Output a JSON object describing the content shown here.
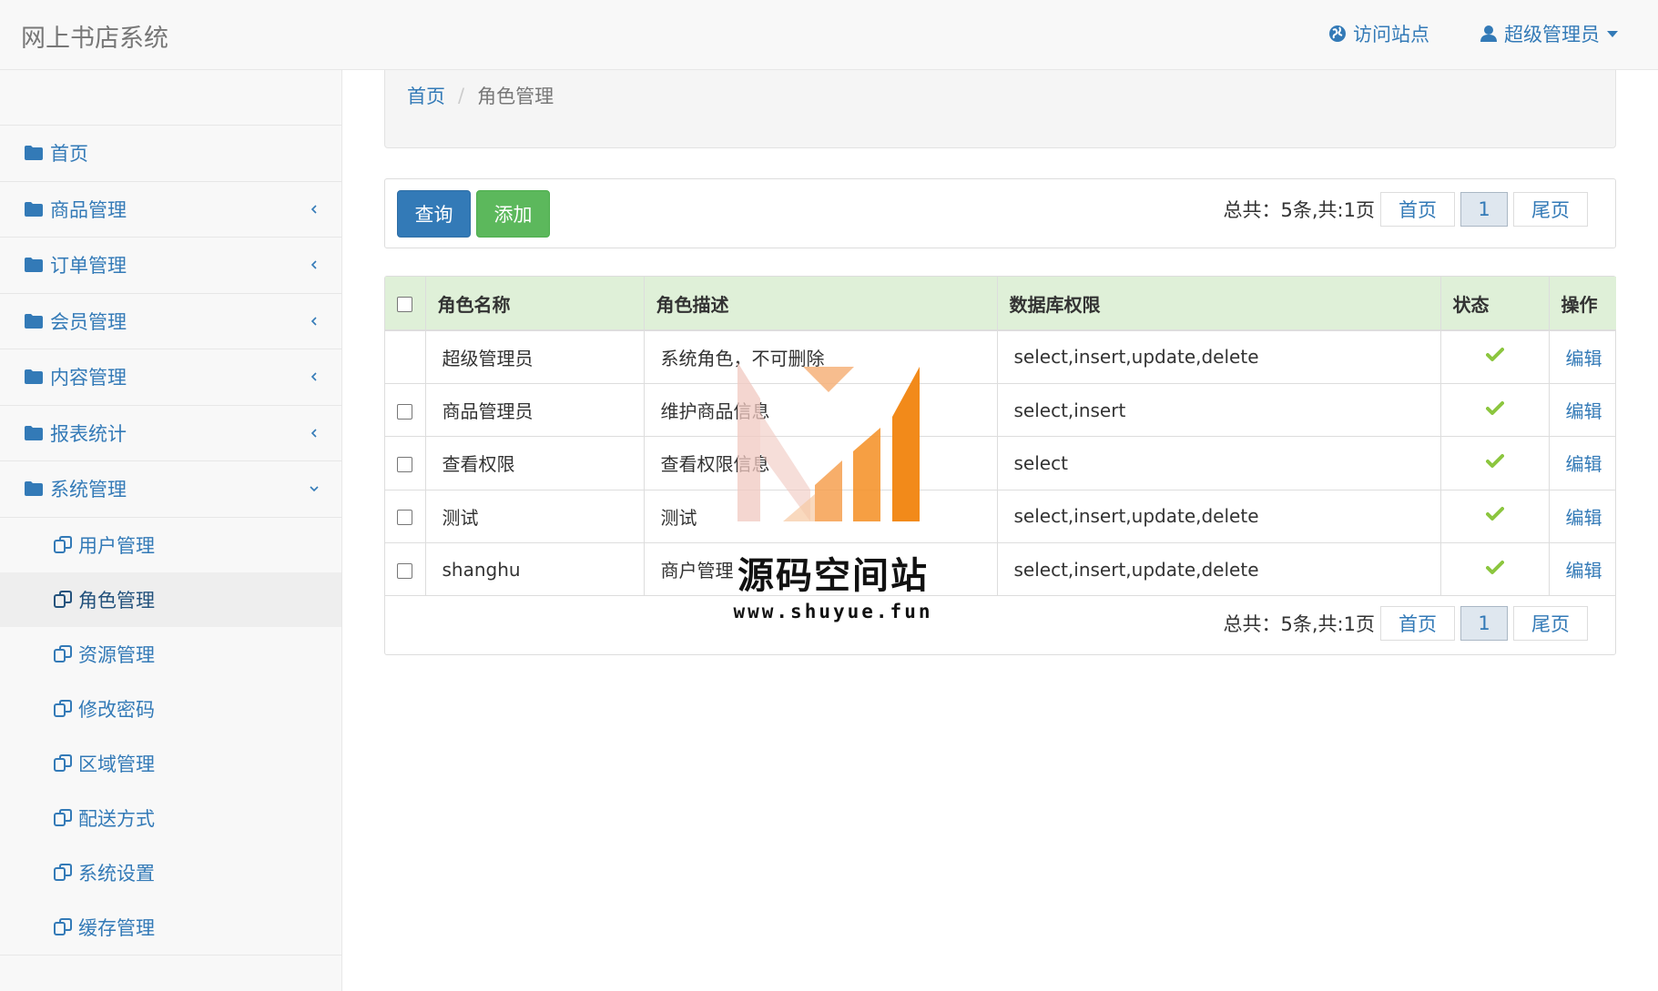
{
  "navbar": {
    "brand": "网上书店系统",
    "visit_site": "访问站点",
    "user_menu": "超级管理员"
  },
  "sidebar": {
    "items": [
      {
        "label": "首页",
        "icon": "folder-icon",
        "expandable": false
      },
      {
        "label": "商品管理",
        "icon": "folder-icon",
        "expandable": true
      },
      {
        "label": "订单管理",
        "icon": "folder-icon",
        "expandable": true
      },
      {
        "label": "会员管理",
        "icon": "folder-icon",
        "expandable": true
      },
      {
        "label": "内容管理",
        "icon": "folder-icon",
        "expandable": true
      },
      {
        "label": "报表统计",
        "icon": "folder-icon",
        "expandable": true
      },
      {
        "label": "系统管理",
        "icon": "folder-icon",
        "expandable": true,
        "expanded": true
      }
    ],
    "sub_items": [
      {
        "label": "用户管理",
        "icon": "copy-icon"
      },
      {
        "label": "角色管理",
        "icon": "copy-icon",
        "active": true
      },
      {
        "label": "资源管理",
        "icon": "copy-icon"
      },
      {
        "label": "修改密码",
        "icon": "copy-icon"
      },
      {
        "label": "区域管理",
        "icon": "copy-icon"
      },
      {
        "label": "配送方式",
        "icon": "copy-icon"
      },
      {
        "label": "系统设置",
        "icon": "copy-icon"
      },
      {
        "label": "缓存管理",
        "icon": "copy-icon"
      }
    ]
  },
  "breadcrumb": {
    "home": "首页",
    "separator": "/",
    "current": "角色管理"
  },
  "toolbar": {
    "query_label": "查询",
    "add_label": "添加"
  },
  "pagination": {
    "total_text": "总共：5条,共:1页",
    "first_label": "首页",
    "current_page": "1",
    "last_label": "尾页"
  },
  "table": {
    "columns": [
      "角色名称",
      "角色描述",
      "数据库权限",
      "状态",
      "操作"
    ],
    "rows": [
      {
        "name": "超级管理员",
        "description": "系统角色，不可删除",
        "permissions": "select,insert,update,delete",
        "status": "enabled",
        "action": "编辑",
        "has_checkbox": false
      },
      {
        "name": "商品管理员",
        "description": "维护商品信息",
        "permissions": "select,insert",
        "status": "enabled",
        "action": "编辑",
        "has_checkbox": true
      },
      {
        "name": "查看权限",
        "description": "查看权限信息",
        "permissions": "select",
        "status": "enabled",
        "action": "编辑",
        "has_checkbox": true
      },
      {
        "name": "测试",
        "description": "测试",
        "permissions": "select,insert,update,delete",
        "status": "enabled",
        "action": "编辑",
        "has_checkbox": true
      },
      {
        "name": "shanghu",
        "description": "商户管理",
        "permissions": "select,insert,update,delete",
        "status": "enabled",
        "action": "编辑",
        "has_checkbox": true
      }
    ]
  },
  "watermark": {
    "title": "源码空间站",
    "url": "www.shuyue.fun"
  },
  "colors": {
    "link": "#337ab7",
    "primary_button": "#337ab7",
    "success_button": "#5cb85c",
    "table_header": "#dff0d8",
    "status_check": "#8cc63f",
    "watermark_orange": "#f28a1a",
    "watermark_pink": "#f0c8c0"
  }
}
